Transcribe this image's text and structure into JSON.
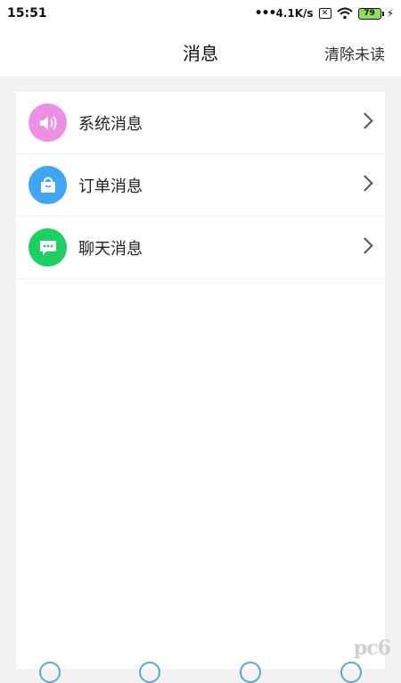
{
  "status_bar": {
    "time": "15:51",
    "network_speed": "4.1K/s",
    "sim_label": "✕",
    "battery": "79"
  },
  "header": {
    "title": "消息",
    "clear_unread": "清除未读"
  },
  "messages": [
    {
      "label": "系统消息",
      "icon": "speaker-icon",
      "color": "#ee8fe6"
    },
    {
      "label": "订单消息",
      "icon": "shopping-bag-icon",
      "color": "#3ea6f2"
    },
    {
      "label": "聊天消息",
      "icon": "chat-bubble-icon",
      "color": "#1fcf64"
    }
  ],
  "watermark": "pc6"
}
